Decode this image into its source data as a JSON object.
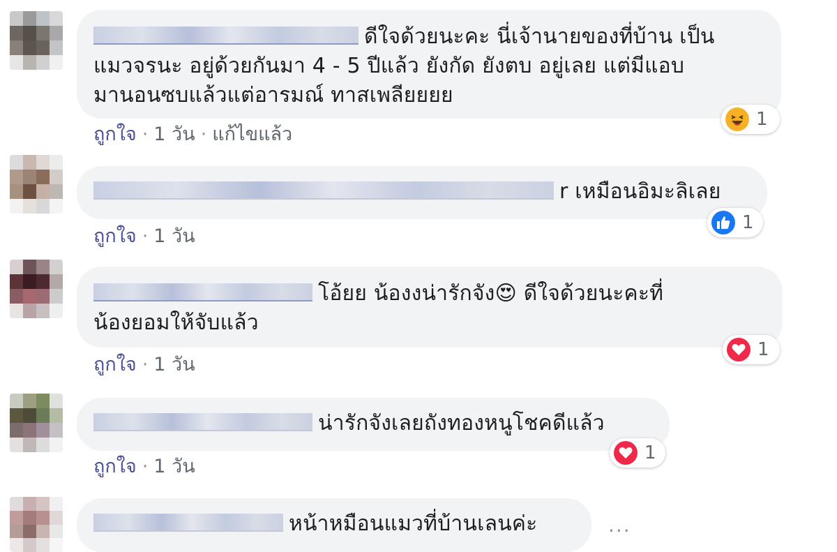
{
  "comments": [
    {
      "text": "ดีใจด้วยนะคะ นี่เจ้านายของที่บ้าน เป็น\nแมวจรนะ อยู่ด้วยกันมา 4 - 5 ปีแล้ว ยังกัด ยังตบ อยู่เลย แต่มีแอบ\nมานอนซบแล้วแต่อารมณ์ ทาสเพลียยยย",
      "like_label": "ถูกใจ",
      "time": "1 วัน",
      "edited": "แก้ไขแล้ว",
      "reaction": {
        "icon": "laugh-icon",
        "count": "1"
      }
    },
    {
      "text": "r เหมือนอิมะลิเลย",
      "like_label": "ถูกใจ",
      "time": "1 วัน",
      "reaction": {
        "icon": "like-icon",
        "count": "1"
      }
    },
    {
      "text": "โอ้ยย น้องงน่ารักจัง😍 ดีใจด้วยนะคะที่\nน้องยอมให้จับแล้ว",
      "like_label": "ถูกใจ",
      "time": "1 วัน",
      "reaction": {
        "icon": "love-icon",
        "count": "1"
      }
    },
    {
      "text": "น่ารักจังเลยถังทองหนูโชคดีแล้ว",
      "like_label": "ถูกใจ",
      "time": "1 วัน",
      "reaction": {
        "icon": "love-icon",
        "count": "1"
      }
    },
    {
      "text": "หน้าหมือนแมวที่บ้านเลนค่ะ",
      "more": "..."
    }
  ],
  "colors": {
    "bubble": "#f2f3f5",
    "like_blue": "#1877f2",
    "love_red": "#f0284a",
    "haha_yellow": "#f7b125",
    "link": "#4b4f9a"
  }
}
